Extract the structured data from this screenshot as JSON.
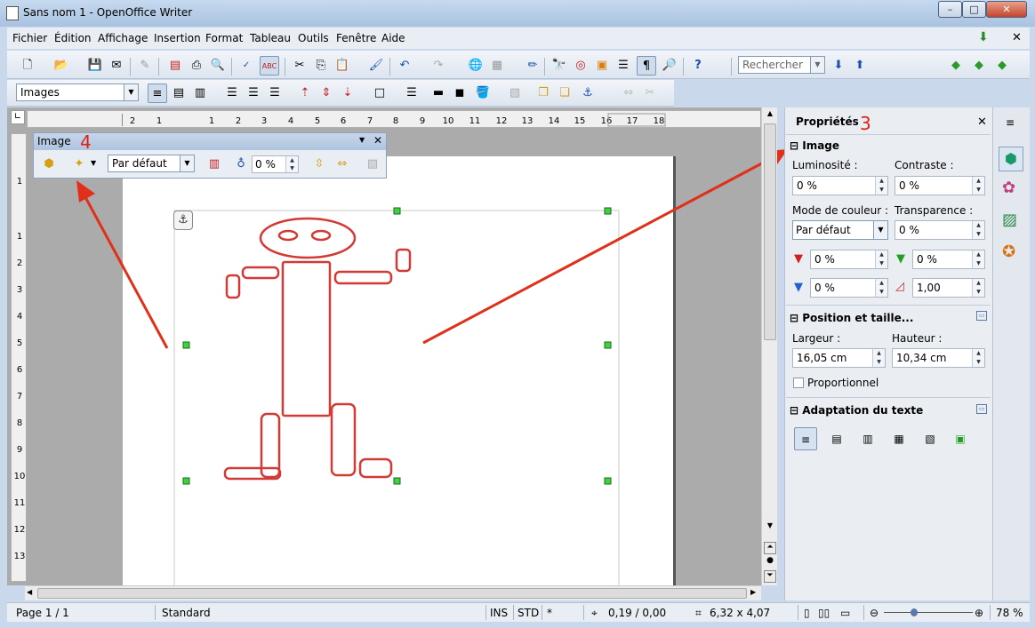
{
  "window": {
    "title": "Sans nom 1 - OpenOffice Writer"
  },
  "menu": [
    "Fichier",
    "Édition",
    "Affichage",
    "Insertion",
    "Format",
    "Tableau",
    "Outils",
    "Fenêtre",
    "Aide"
  ],
  "toolbar": {
    "search_placeholder": "Rechercher",
    "style_value": "Images"
  },
  "ruler": {
    "h_ticks": [
      "2",
      "1",
      "1",
      "2",
      "3",
      "4",
      "5",
      "6",
      "7",
      "8",
      "9",
      "10",
      "11",
      "12",
      "13",
      "14",
      "15",
      "16",
      "17",
      "18"
    ],
    "v_ticks": [
      "1",
      "1",
      "2",
      "3",
      "4",
      "5",
      "6",
      "7",
      "8",
      "9",
      "10",
      "11",
      "12",
      "13"
    ]
  },
  "image_toolbar": {
    "title": "Image",
    "mode_value": "Par défaut",
    "transparency_value": "0 %"
  },
  "sidebar": {
    "title": "Propriétés",
    "image": {
      "title": "Image",
      "brightness_label": "Luminosité :",
      "brightness_value": "0 %",
      "contrast_label": "Contraste :",
      "contrast_value": "0 %",
      "color_mode_label": "Mode de couleur :",
      "color_mode_value": "Par défaut",
      "transparency_label": "Transparence :",
      "transparency_value": "0 %",
      "red_value": "0 %",
      "green_value": "0 %",
      "blue_value": "0 %",
      "gamma_value": "1,00"
    },
    "position": {
      "title": "Position et taille...",
      "width_label": "Largeur :",
      "width_value": "16,05 cm",
      "height_label": "Hauteur :",
      "height_value": "10,34 cm",
      "proportional_label": "Proportionnel"
    },
    "wrap": {
      "title": "Adaptation du texte"
    }
  },
  "annotations": {
    "a3": "3",
    "a4": "4"
  },
  "status": {
    "page": "Page 1 / 1",
    "style": "Standard",
    "ins": "INS",
    "std": "STD",
    "star": "*",
    "pos": "0,19 / 0,00",
    "size": "6,32 x 4,07",
    "zoom": "78 %"
  },
  "colors": {
    "accent": "#d23a36",
    "arrow": "#e0301a",
    "handle": "#3fd23f"
  }
}
